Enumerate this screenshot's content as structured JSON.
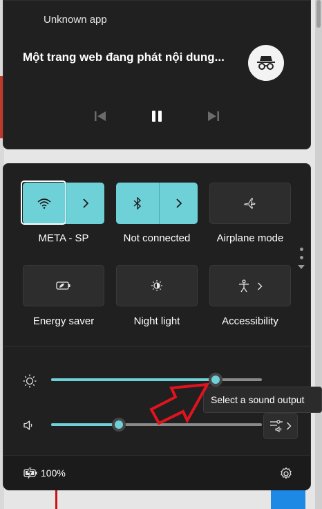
{
  "media": {
    "app_name": "Unknown app",
    "title": "Một trang web đang phát nội dung...",
    "badge_icon": "incognito-icon",
    "controls": [
      "previous-icon",
      "pause-icon",
      "next-icon"
    ]
  },
  "quick_settings": {
    "tiles": [
      {
        "label": "META - SP",
        "icon": "wifi-icon",
        "state": "on",
        "has_expand": true
      },
      {
        "label": "Not connected",
        "icon": "bluetooth-icon",
        "state": "on",
        "has_expand": true
      },
      {
        "label": "Airplane mode",
        "icon": "airplane-icon",
        "state": "off",
        "has_expand": false
      },
      {
        "label": "Energy saver",
        "icon": "energy-saver-icon",
        "state": "off",
        "has_expand": false
      },
      {
        "label": "Night light",
        "icon": "night-light-icon",
        "state": "off",
        "has_expand": false
      },
      {
        "label": "Accessibility",
        "icon": "accessibility-icon",
        "state": "off",
        "has_expand": true
      }
    ],
    "brightness": {
      "icon": "brightness-icon",
      "level_percent": 78
    },
    "volume": {
      "icon": "speaker-icon",
      "level_percent": 32
    },
    "sound_output": {
      "icon": "sound-output-icon"
    },
    "battery": {
      "icon": "battery-charging-icon",
      "text": "100%"
    },
    "settings_icon": "gear-icon"
  },
  "tooltip": {
    "text": "Select a sound output"
  },
  "colors": {
    "accent": "#6fd1d8",
    "panel": "#202020",
    "tile_off": "#2d2d2d",
    "annotation": "#e0141e"
  }
}
